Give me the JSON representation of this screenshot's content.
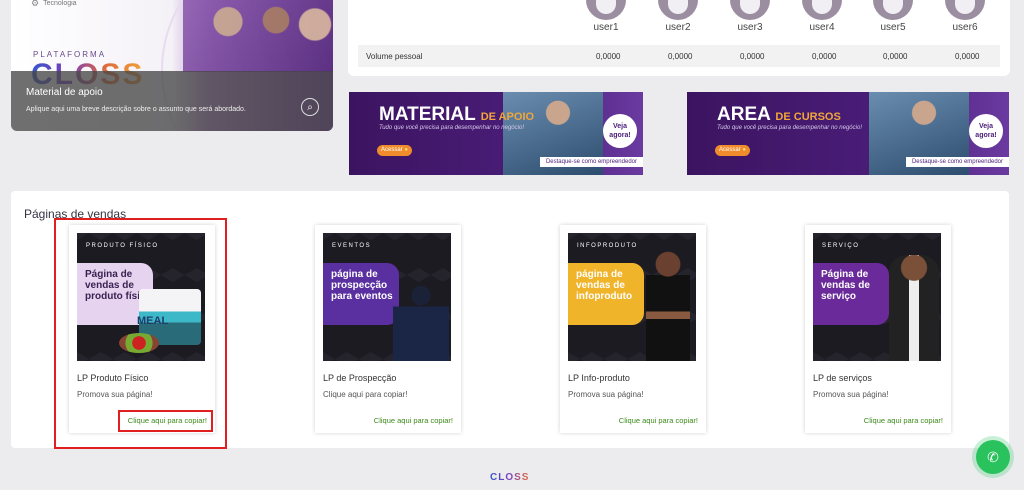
{
  "feature": {
    "tag": "Tecnologia",
    "plataforma": "PLATAFORMA",
    "logo": "CLOSS",
    "title": "Material de apoio",
    "description": "Aplique aqui uma breve descrição sobre o assunto que será abordado."
  },
  "users": {
    "names": [
      "user1",
      "user2",
      "user3",
      "user4",
      "user5",
      "user6"
    ],
    "row_label": "Volume pessoal",
    "values": [
      "0,0000",
      "0,0000",
      "0,0000",
      "0,0000",
      "0,0000",
      "0,0000"
    ]
  },
  "banners": [
    {
      "title_main": "MATERIAL",
      "title_accent": "DE APOIO",
      "subtitle": "Tudo que você precisa para desempenhar no negócio!",
      "button": "Acessar",
      "badge": "Veja agora!",
      "strip": "Destaque-se como empreendedor"
    },
    {
      "title_main": "AREA",
      "title_accent": "DE CURSOS",
      "subtitle": "Tudo que você precisa para desempenhar no negócio!",
      "button": "Acessar",
      "badge": "Veja agora!",
      "strip": "Destaque-se como empreendedor"
    }
  ],
  "sales": {
    "title": "Páginas de vendas",
    "cards": [
      {
        "label": "PRODUTO FÍSICO",
        "box": "Página de vendas de produto físico",
        "name": "LP Produto Físico",
        "promo": "Promova sua página!",
        "copy": "Clique aqui para copiar!",
        "box_bg": "#e6d3f0",
        "box_fg": "#3a2250",
        "product_text": "MEAL"
      },
      {
        "label": "EVENTOS",
        "box": "página de prospecção para eventos",
        "name": "LP de Prospecção",
        "promo": "Clique aqui para copiar!",
        "copy": "Clique aqui para copiar!",
        "box_bg": "#5a2fa0",
        "box_fg": "#ffffff"
      },
      {
        "label": "INFOPRODUTO",
        "box": "página de vendas de infoproduto",
        "name": "LP Info-produto",
        "promo": "Promova sua página!",
        "copy": "Clique aqui para copiar!",
        "box_bg": "#f0b42a",
        "box_fg": "#ffffff"
      },
      {
        "label": "SERVIÇO",
        "box": "Página de vendas de serviço",
        "name": "LP de serviços",
        "promo": "Promova sua página!",
        "copy": "Clique aqui para copiar!",
        "box_bg": "#6a2a9a",
        "box_fg": "#ffffff"
      }
    ]
  },
  "footer": {
    "logo": "CLOSS"
  },
  "colors": {
    "accent": "#4a1d78",
    "highlight": "#e02020",
    "copy_link": "#3c8a1a",
    "whatsapp": "#29c25d"
  },
  "icons": {
    "whatsapp": "whatsapp-icon",
    "search": "search-icon",
    "tag": "gear-icon"
  }
}
